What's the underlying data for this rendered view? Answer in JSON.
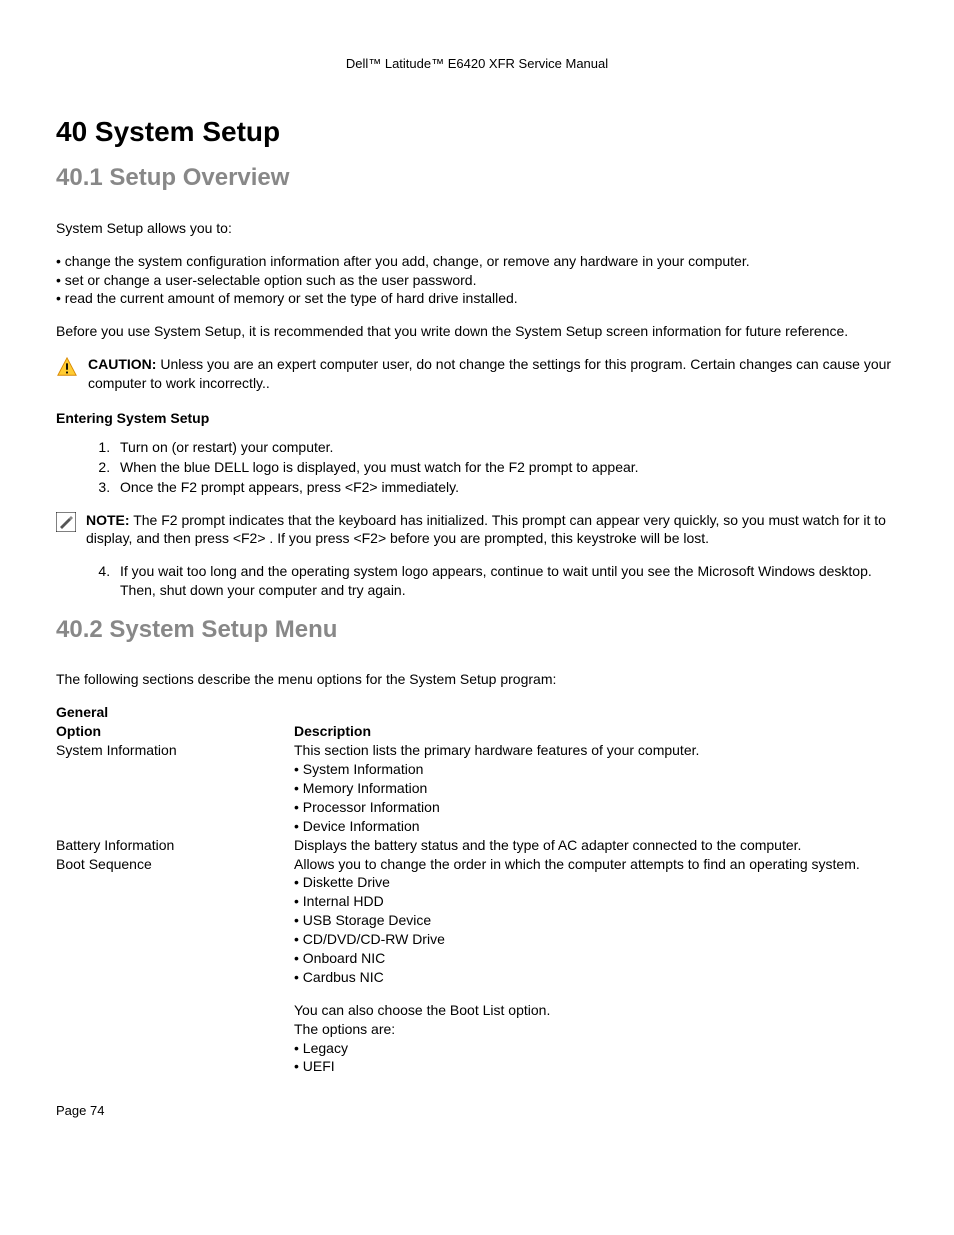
{
  "header": {
    "text": "Dell™ Latitude™ E6420 XFR Service Manual"
  },
  "h1": "40  System Setup",
  "h2a": "40.1  Setup Overview",
  "intro": "System Setup allows you to:",
  "intro_bullets": [
    "change the system configuration information after you add, change, or remove any hardware in your computer.",
    "set or change a user-selectable option such as the user password.",
    "read the current amount of memory or set the type of hard drive installed."
  ],
  "before_text": "Before you use System Setup, it is recommended that you write down the System Setup screen information for future reference.",
  "caution": {
    "label": "CAUTION:",
    "text": " Unless you are an expert computer user, do not change the settings for this program. Certain changes can cause your computer to work incorrectly.."
  },
  "entering_heading": "Entering System Setup",
  "steps_a": [
    "Turn on (or restart) your computer.",
    "When the blue DELL logo is displayed, you must watch for the F2 prompt to appear.",
    "Once the F2 prompt appears, press <F2> immediately."
  ],
  "note": {
    "label": "NOTE:",
    "text": " The F2 prompt indicates that the keyboard has initialized. This prompt can appear very quickly, so you must watch for it to display, and then press <F2> . If you press <F2> before you are prompted, this keystroke will be lost."
  },
  "steps_b": [
    "If you wait too long and the operating system logo appears, continue to wait until you see the Microsoft Windows desktop. Then, shut down your computer and try again."
  ],
  "h2b": "40.2  System Setup Menu",
  "menu_intro": "The following sections describe the menu options for the System Setup program:",
  "table": {
    "group": "General",
    "head_option": "Option",
    "head_desc": "Description",
    "rows": [
      {
        "option": "System Information",
        "desc": "This section lists the primary hardware features of your computer.",
        "bullets": [
          "System Information",
          "Memory Information",
          "Processor Information",
          "Device Information"
        ]
      },
      {
        "option": "Battery Information",
        "desc": "Displays the battery status and the type of AC adapter connected to the computer."
      },
      {
        "option": "Boot Sequence",
        "desc": "Allows you to change the order in which the computer attempts to find an operating system.",
        "bullets": [
          "Diskette Drive",
          "Internal HDD",
          "USB Storage Device",
          "CD/DVD/CD-RW Drive",
          "Onboard NIC",
          "Cardbus NIC"
        ],
        "extra1": "You can also choose the Boot List option.",
        "extra2": "The options are:",
        "bullets2": [
          "Legacy",
          "UEFI"
        ]
      }
    ]
  },
  "footer": "Page 74"
}
